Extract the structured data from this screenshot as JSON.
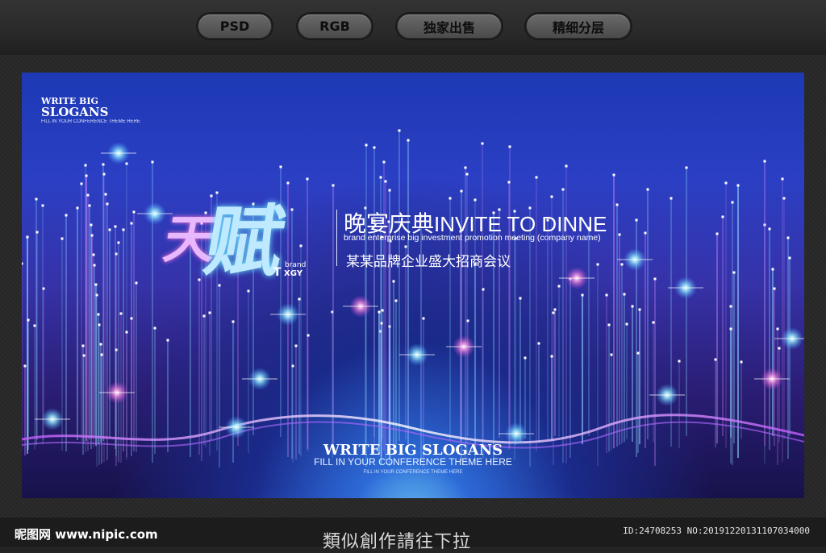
{
  "tabs": [
    "PSD",
    "RGB",
    "独家出售",
    "精细分层"
  ],
  "poster": {
    "corner_line1": "WRITE BIG",
    "corner_line2": "SLOGANS",
    "corner_line3": "FILL IN YOUR CONFERENCE THEME HERE",
    "logo_char": "赋",
    "logo_prefix": "天",
    "brand_small": "brand",
    "brand_t": "T",
    "brand_xgy": "XGY",
    "headline_cn": "晚宴庆典",
    "headline_en": "INVITE TO DINNE",
    "subline_en": "brand enterprise big investment promotion meeting (company name)",
    "subline_cn": "某某品牌企业盛大招商会议",
    "bottom_title": "WRITE BIG SLOGANS",
    "bottom_sub": "FILL IN YOUR CONFERENCE THEME HERE",
    "bottom_sub2": "FILL IN YOUR CONFERENCE THEME HERE"
  },
  "footer": {
    "site": "昵图网 www.nipic.com",
    "note": "類似創作請往下拉",
    "id": "ID:24708253 NO:20191220131107034000"
  },
  "colors": {
    "accent_cyan": "#6fe8ff",
    "accent_pink": "#ff7ad6",
    "poster_blue": "#2b3fc4"
  }
}
